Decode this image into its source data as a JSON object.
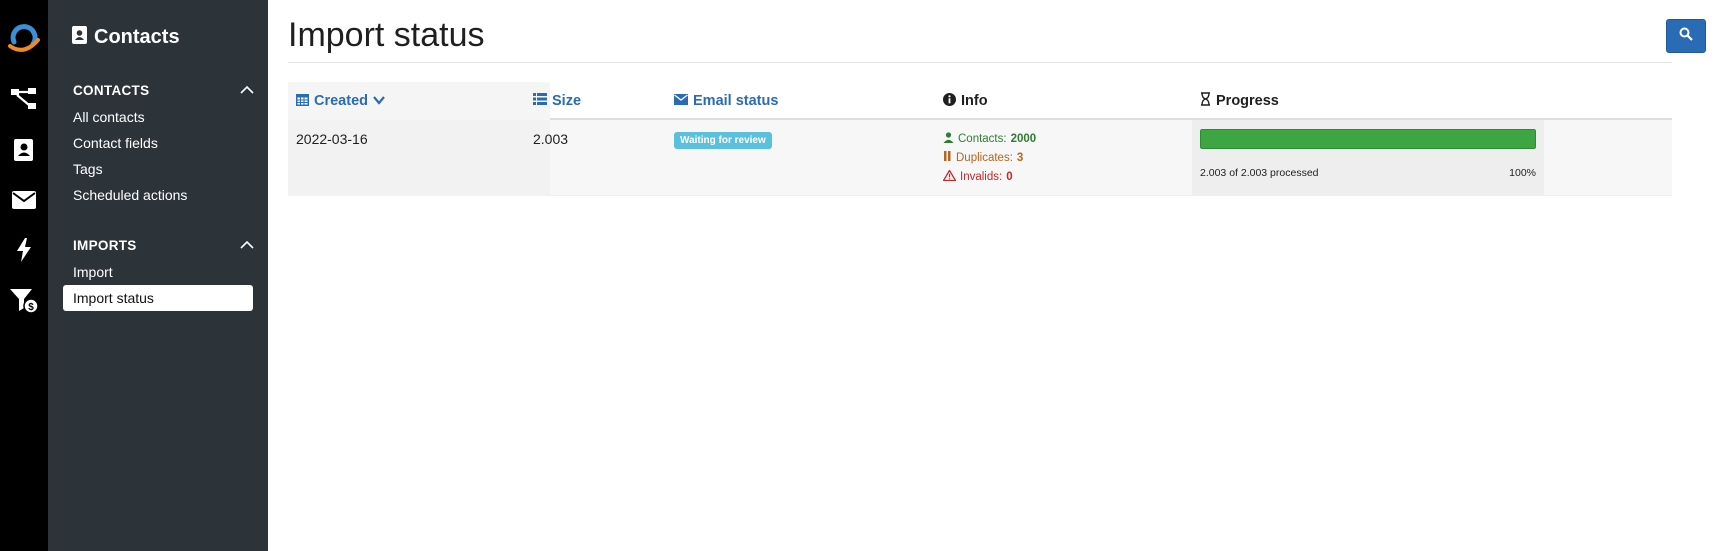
{
  "app": {
    "icons": [
      "logo-icon",
      "flow-icon",
      "contacts-icon",
      "email-icon",
      "lightning-icon",
      "filter-dollar-icon"
    ]
  },
  "sidebar": {
    "title": "Contacts",
    "sections": [
      {
        "label": "CONTACTS",
        "items": [
          "All contacts",
          "Contact fields",
          "Tags",
          "Scheduled actions"
        ]
      },
      {
        "label": "IMPORTS",
        "items": [
          "Import",
          "Import status"
        ]
      }
    ],
    "active_item": "Import status"
  },
  "page": {
    "title": "Import status"
  },
  "table": {
    "headers": {
      "created": "Created",
      "size": "Size",
      "email_status": "Email status",
      "info": "Info",
      "progress": "Progress"
    },
    "rows": [
      {
        "created": "2022-03-16",
        "size": "2.003",
        "email_status": "Waiting for review",
        "info": {
          "contacts_label": "Contacts:",
          "contacts_value": "2000",
          "duplicates_label": "Duplicates:",
          "duplicates_value": "3",
          "invalids_label": "Invalids:",
          "invalids_value": "0"
        },
        "progress": {
          "label": "2.003 of 2.003 processed",
          "percent_text": "100%",
          "fraction": 1.0
        }
      }
    ]
  },
  "colors": {
    "accent": "#2a6bb5",
    "sidebar_bg": "#2c3439",
    "rail_bg": "#000000",
    "badge": "#5bc0de",
    "progress": "#3ea543",
    "contacts": "#2e7d32",
    "duplicates": "#b5651d",
    "invalids": "#c62828"
  }
}
